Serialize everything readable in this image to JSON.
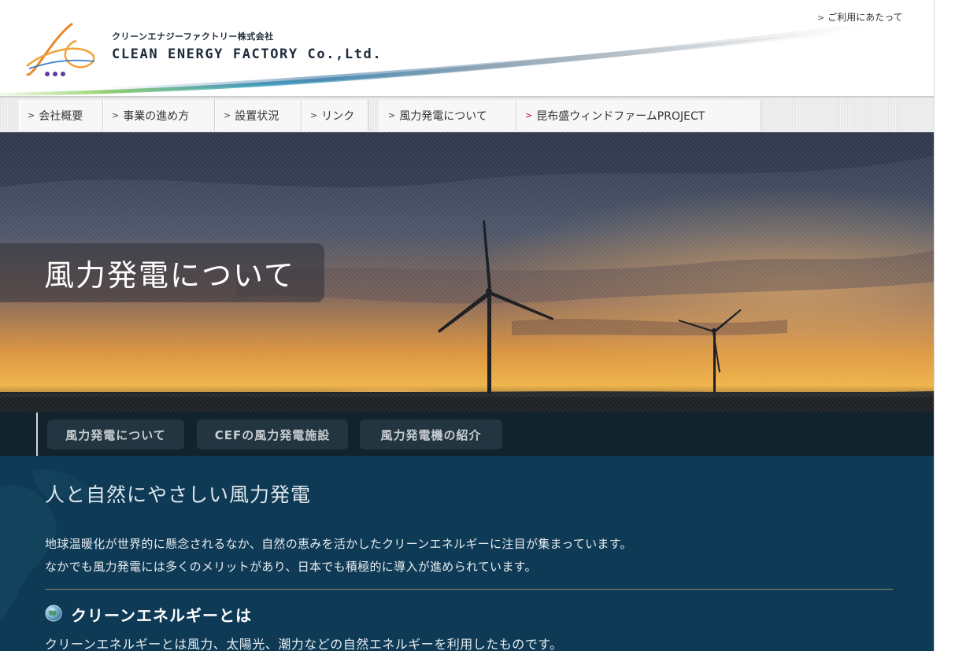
{
  "header": {
    "company_name_jp": "クリーンエナジーファクトリー株式会社",
    "company_name_en": "CLEAN ENERGY FACTORY Co.,Ltd.",
    "logo_text": "CEF",
    "usage_link": "ご利用にあたって"
  },
  "main_nav": {
    "items": [
      {
        "label": "会社概要"
      },
      {
        "label": "事業の進め方"
      },
      {
        "label": "設置状況"
      },
      {
        "label": "リンク"
      },
      {
        "label": "風力発電について"
      },
      {
        "label": "昆布盛ウィンドファームPROJECT"
      }
    ]
  },
  "hero": {
    "title": "風力発電について"
  },
  "sub_nav": {
    "tabs": [
      {
        "label": "風力発電について"
      },
      {
        "label": "CEFの風力発電施設"
      },
      {
        "label": "風力発電機の紹介"
      }
    ]
  },
  "content": {
    "heading": "人と自然にやさしい風力発電",
    "paragraphs": [
      "地球温暖化が世界的に懸念されるなか、自然の恵みを活かしたクリーンエネルギーに注目が集まっています。",
      "なかでも風力発電には多くのメリットがあり、日本でも積極的に導入が進められています。"
    ],
    "section_title": "クリーンエネルギーとは",
    "section_text": "クリーンエネルギーとは風力、太陽光、潮力などの自然エネルギーを利用したものです。"
  },
  "colors": {
    "content_bg": "#0f3a56",
    "sub_nav_bg": "#13232d",
    "accent_red": "#c8102e"
  }
}
